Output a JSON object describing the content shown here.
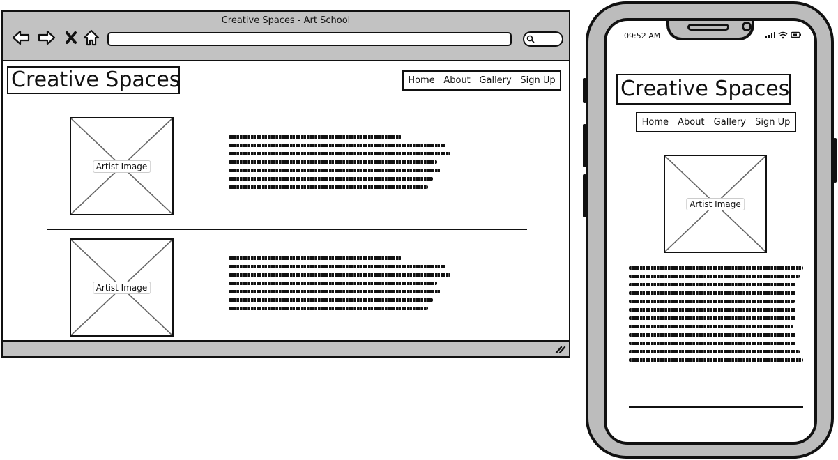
{
  "browser": {
    "window_title": "Creative Spaces - Art School",
    "nav_icons": [
      "back-icon",
      "forward-icon",
      "close-icon",
      "home-icon"
    ]
  },
  "site": {
    "logo": "Creative Spaces",
    "menu": [
      "Home",
      "About",
      "Gallery",
      "Sign Up"
    ],
    "image_label": "Artist Image"
  },
  "phone": {
    "time": "09:52 AM"
  },
  "colors": {
    "chrome_gray": "#c2c2c2",
    "ink": "#111111",
    "phone_body": "#bcbcbc"
  }
}
